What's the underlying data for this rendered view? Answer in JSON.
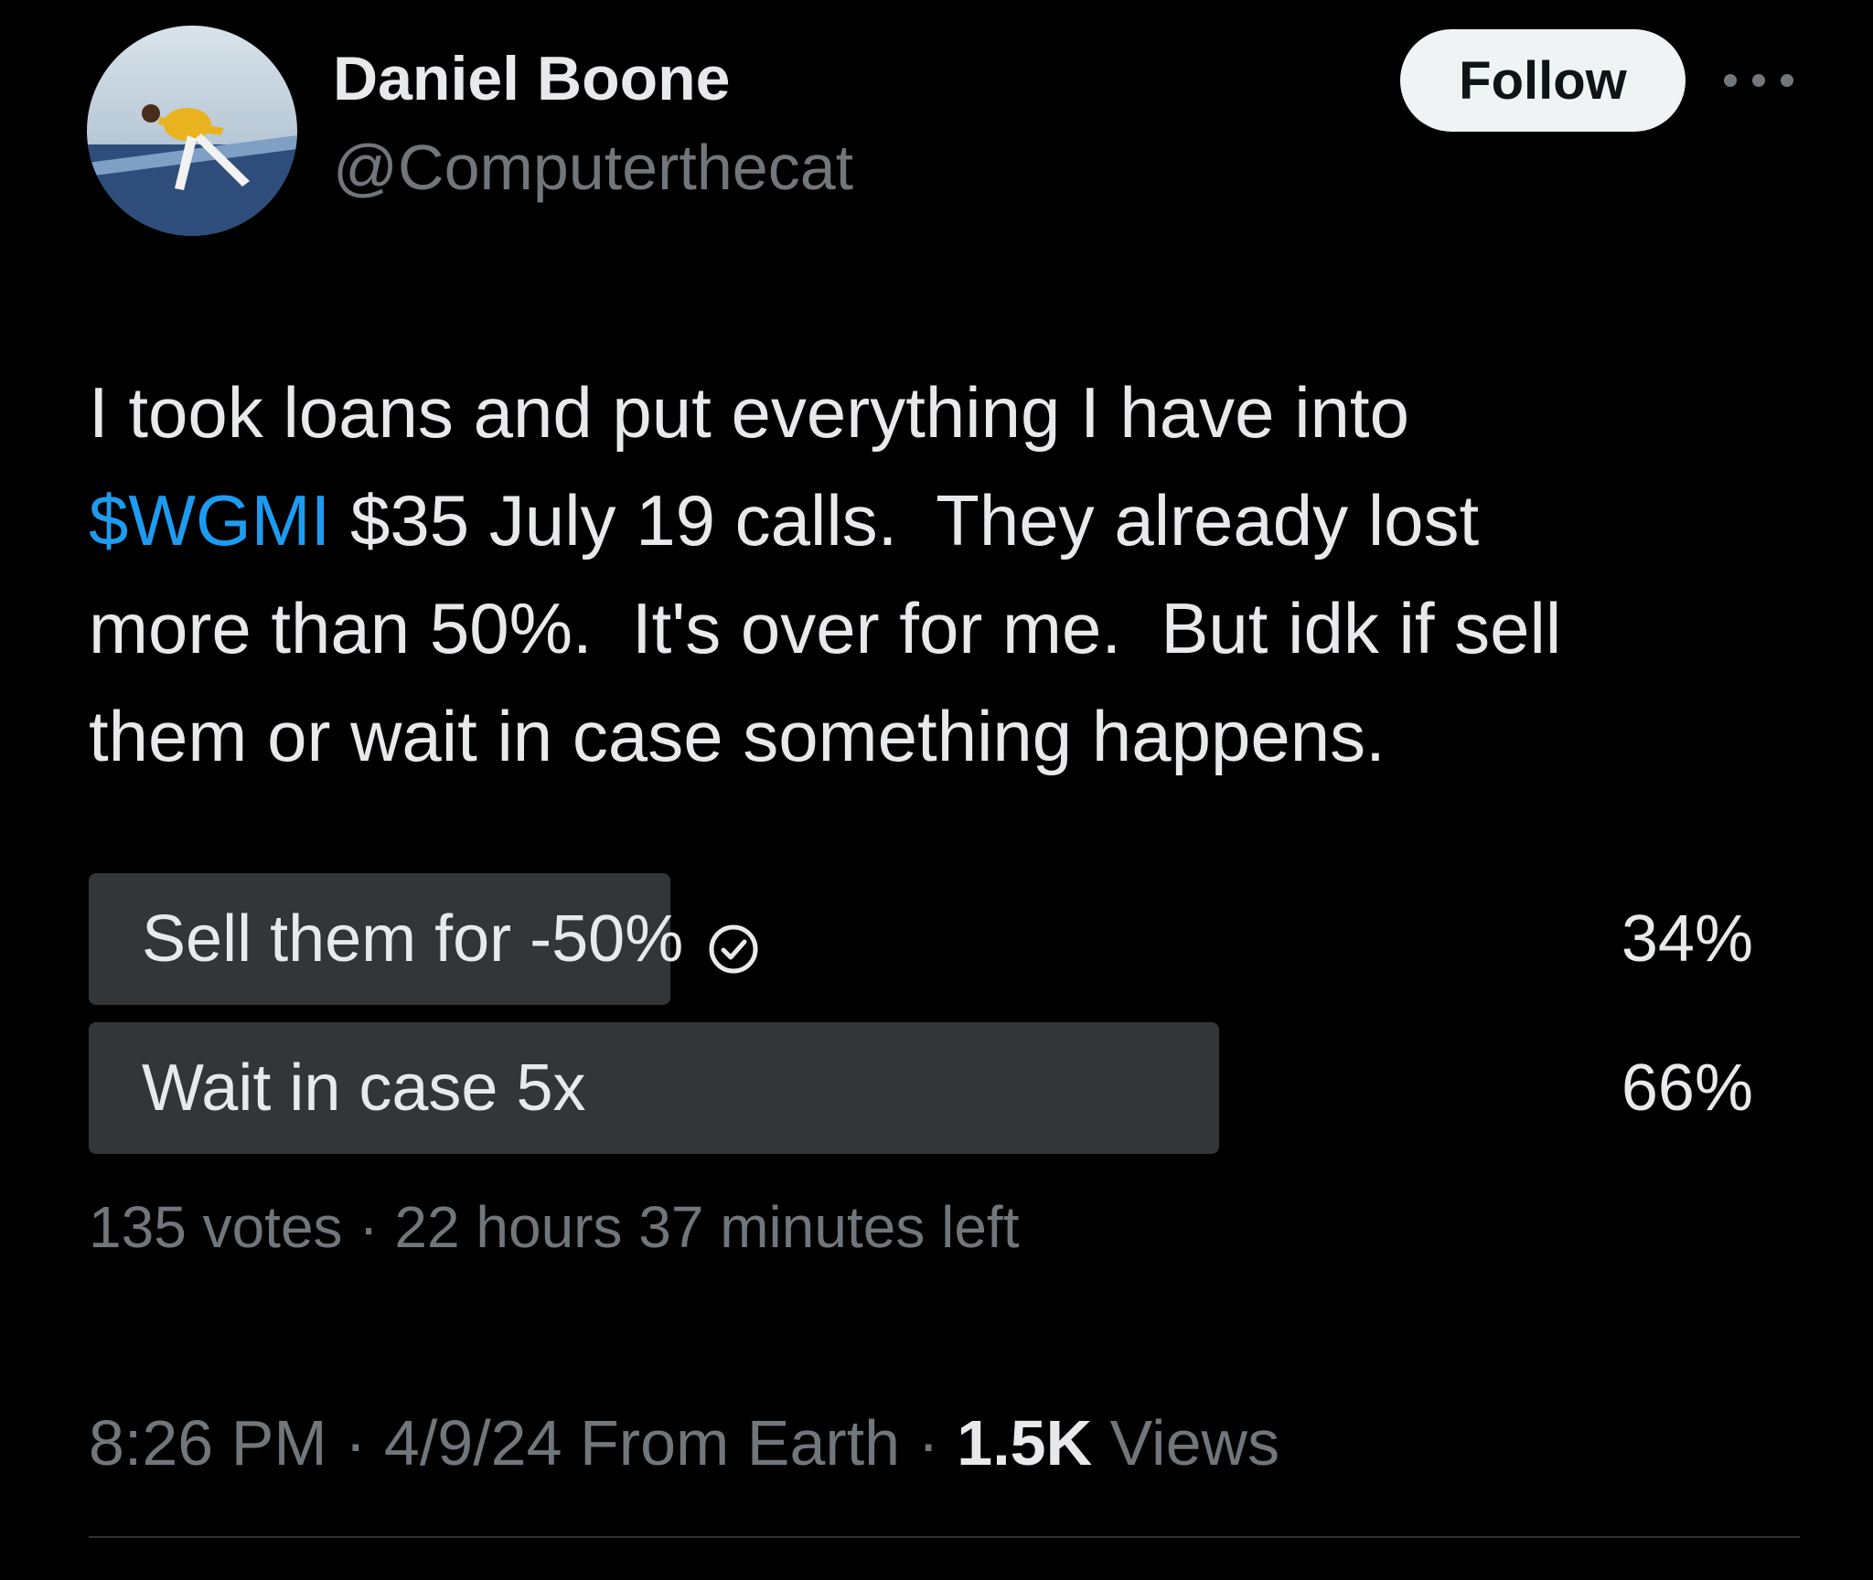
{
  "author": {
    "display_name": "Daniel Boone",
    "handle": "@Computerthecat",
    "avatar_icon": "profile-photo"
  },
  "header": {
    "follow_label": "Follow",
    "more_icon": "more-dots-icon"
  },
  "tweet": {
    "line_1": "I took loans and put everything I have into",
    "cashtag": "$WGMI",
    "line_2_rest": " $35 July 19 calls.  They already lost",
    "line_3": "more than 50%.  It's over for me.  But idk if sell",
    "line_4": "them or wait in case something happens."
  },
  "poll": {
    "options": [
      {
        "label": "Sell them for -50%",
        "percent": "34%",
        "selected": true
      },
      {
        "label": "Wait in case 5x",
        "percent": "66%",
        "selected": false
      }
    ],
    "votes": "135 votes",
    "separator": " · ",
    "time_left": "22 hours 37 minutes left"
  },
  "meta": {
    "time": "8:26 PM",
    "date": "4/9/24",
    "source": "From Earth",
    "views_count": "1.5K",
    "views_label": "Views",
    "separator": " · "
  },
  "colors": {
    "background": "#000000",
    "primary_text": "#e7e9ea",
    "secondary_text": "#71767b",
    "accent": "#1d9bf0",
    "poll_bar": "#333639",
    "follow_bg": "#eff3f4"
  }
}
